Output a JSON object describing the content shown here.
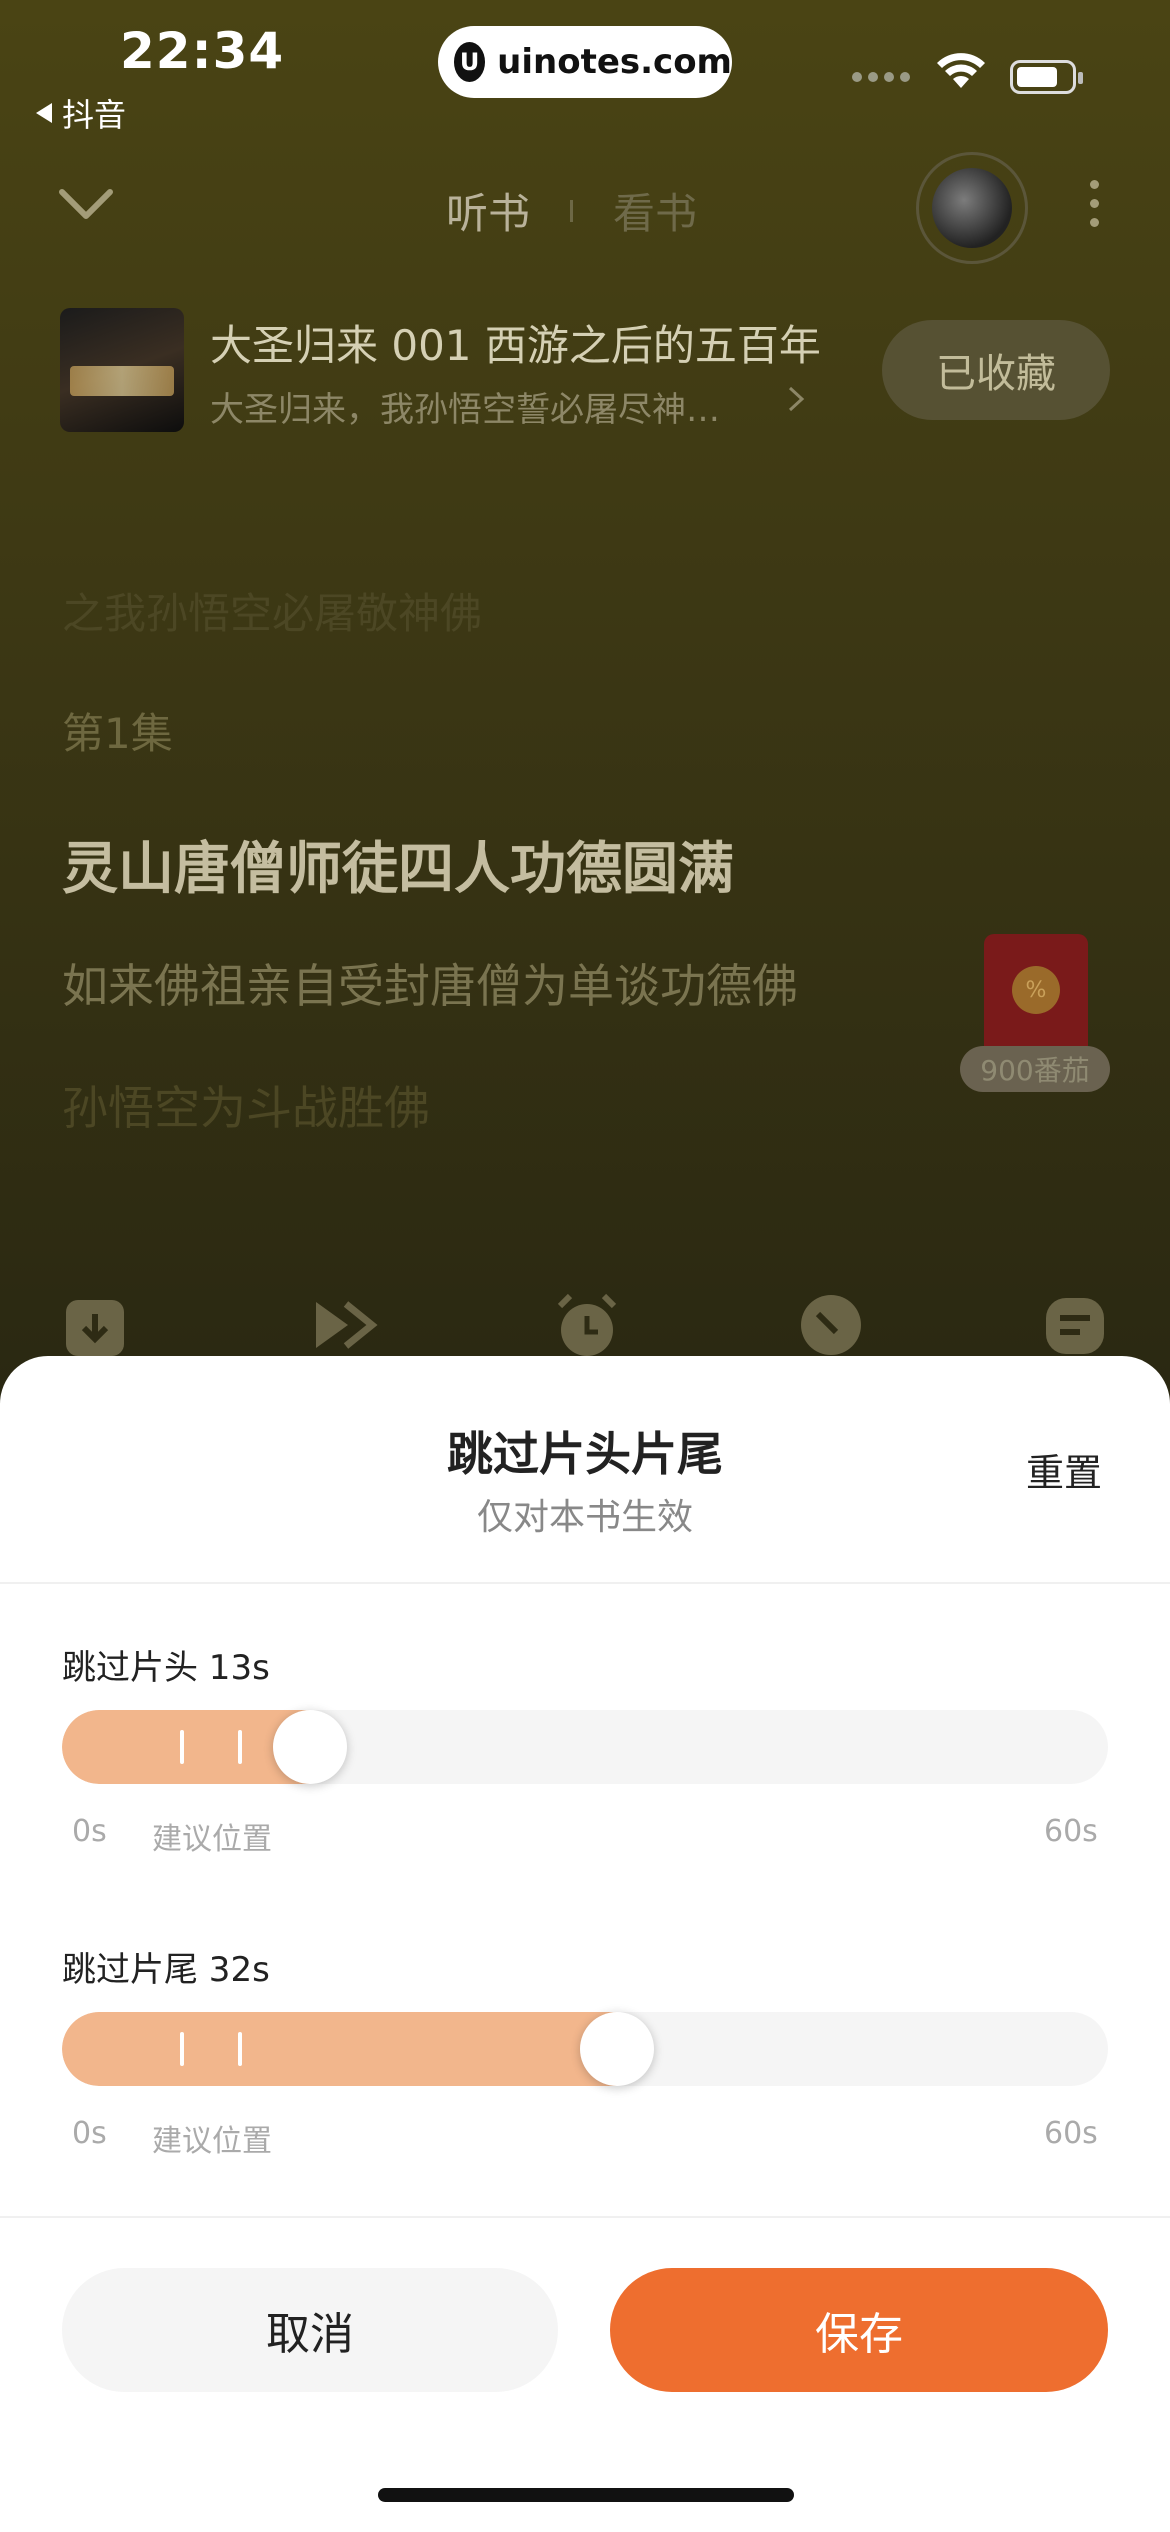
{
  "status_bar": {
    "time": "22:34",
    "back_app": "抖音",
    "url": "uinotes.com"
  },
  "header": {
    "tab_listen": "听书",
    "tab_read": "看书"
  },
  "book": {
    "title": "大圣归来 001 西游之后的五百年",
    "subtitle": "大圣归来，我孙悟空誓必屠尽神…",
    "collect_label": "已收藏"
  },
  "lyrics": [
    "之我孙悟空必屠敬神佛",
    "第1集",
    "灵山唐僧师徒四人功德圆满",
    "如来佛祖亲自受封唐僧为单谈功德佛",
    "孙悟空为斗战胜佛"
  ],
  "red_packet": {
    "badge": "900番茄"
  },
  "sheet": {
    "title": "跳过片头片尾",
    "subtitle": "仅对本书生效",
    "reset_label": "重置",
    "intro": {
      "label": "跳过片头 13s",
      "value": 13,
      "max": 60,
      "min_label": "0s",
      "hint_label": "建议位置",
      "max_label": "60s"
    },
    "outro": {
      "label": "跳过片尾 32s",
      "value": 32,
      "max": 60,
      "min_label": "0s",
      "hint_label": "建议位置",
      "max_label": "60s"
    },
    "cancel_label": "取消",
    "save_label": "保存"
  },
  "colors": {
    "accent": "#ee6e2f",
    "slider_fill": "#f2b68c"
  }
}
